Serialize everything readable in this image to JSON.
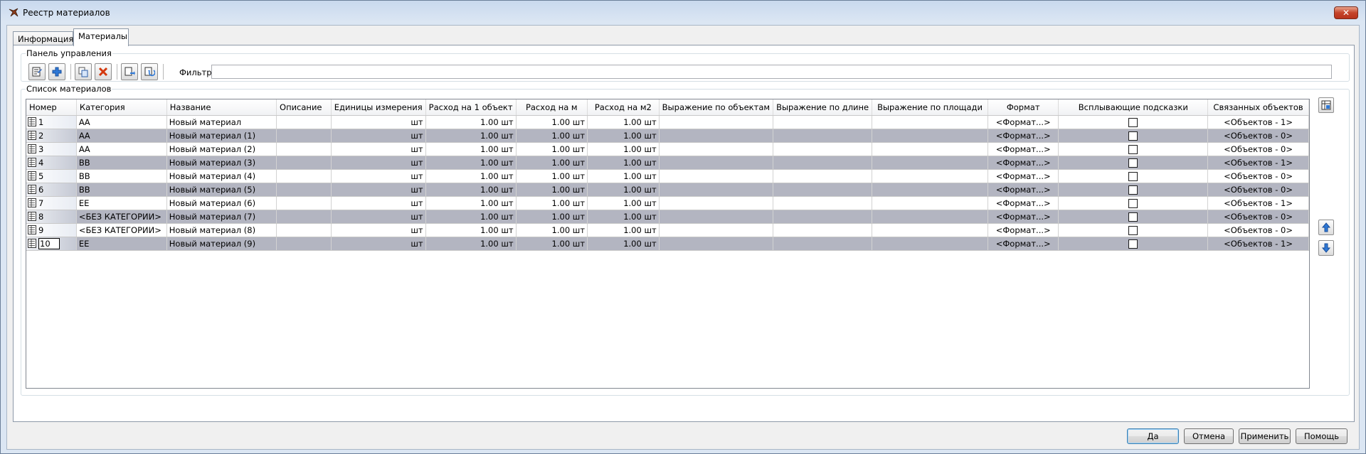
{
  "window": {
    "title": "Реестр материалов"
  },
  "tabs": [
    {
      "label": "Информация",
      "active": false
    },
    {
      "label": "Материалы",
      "active": true
    }
  ],
  "control_panel": {
    "title": "Панель управления",
    "buttons": [
      {
        "icon": "properties-icon"
      },
      {
        "icon": "add-icon"
      },
      {
        "icon": "copy-icon"
      },
      {
        "icon": "delete-icon"
      },
      {
        "icon": "export-icon"
      },
      {
        "icon": "import-icon"
      }
    ],
    "filter_label": "Фильтр:",
    "filter_value": ""
  },
  "materials": {
    "title": "Список материалов",
    "columns": [
      "Номер",
      "Категория",
      "Название",
      "Описание",
      "Единицы измерения",
      "Расход на 1 объект",
      "Расход на м",
      "Расход на м2",
      "Выражение по объектам",
      "Выражение по длине",
      "Выражение по площади",
      "Формат",
      "Всплывающие подсказки",
      "Связанных объектов"
    ],
    "rows": [
      {
        "num": "1",
        "category": "АА",
        "name": "Новый материал",
        "desc": "",
        "unit": "шт",
        "per_object": "1.00 шт",
        "per_m": "1.00 шт",
        "per_m2": "1.00 шт",
        "expr_obj": "",
        "expr_len": "",
        "expr_area": "",
        "format": "<Формат...>",
        "tooltip": false,
        "linked": "<Объектов - 1>"
      },
      {
        "num": "2",
        "category": "АА",
        "name": "Новый материал (1)",
        "desc": "",
        "unit": "шт",
        "per_object": "1.00 шт",
        "per_m": "1.00 шт",
        "per_m2": "1.00 шт",
        "expr_obj": "",
        "expr_len": "",
        "expr_area": "",
        "format": "<Формат...>",
        "tooltip": false,
        "linked": "<Объектов - 0>"
      },
      {
        "num": "3",
        "category": "АА",
        "name": "Новый материал (2)",
        "desc": "",
        "unit": "шт",
        "per_object": "1.00 шт",
        "per_m": "1.00 шт",
        "per_m2": "1.00 шт",
        "expr_obj": "",
        "expr_len": "",
        "expr_area": "",
        "format": "<Формат...>",
        "tooltip": false,
        "linked": "<Объектов - 0>"
      },
      {
        "num": "4",
        "category": "ВВ",
        "name": "Новый материал (3)",
        "desc": "",
        "unit": "шт",
        "per_object": "1.00 шт",
        "per_m": "1.00 шт",
        "per_m2": "1.00 шт",
        "expr_obj": "",
        "expr_len": "",
        "expr_area": "",
        "format": "<Формат...>",
        "tooltip": false,
        "linked": "<Объектов - 1>"
      },
      {
        "num": "5",
        "category": "ВВ",
        "name": "Новый материал (4)",
        "desc": "",
        "unit": "шт",
        "per_object": "1.00 шт",
        "per_m": "1.00 шт",
        "per_m2": "1.00 шт",
        "expr_obj": "",
        "expr_len": "",
        "expr_area": "",
        "format": "<Формат...>",
        "tooltip": false,
        "linked": "<Объектов - 0>"
      },
      {
        "num": "6",
        "category": "ВВ",
        "name": "Новый материал (5)",
        "desc": "",
        "unit": "шт",
        "per_object": "1.00 шт",
        "per_m": "1.00 шт",
        "per_m2": "1.00 шт",
        "expr_obj": "",
        "expr_len": "",
        "expr_area": "",
        "format": "<Формат...>",
        "tooltip": false,
        "linked": "<Объектов - 0>"
      },
      {
        "num": "7",
        "category": "ЕЕ",
        "name": "Новый материал (6)",
        "desc": "",
        "unit": "шт",
        "per_object": "1.00 шт",
        "per_m": "1.00 шт",
        "per_m2": "1.00 шт",
        "expr_obj": "",
        "expr_len": "",
        "expr_area": "",
        "format": "<Формат...>",
        "tooltip": false,
        "linked": "<Объектов - 1>"
      },
      {
        "num": "8",
        "category": "<БЕЗ КАТЕГОРИИ>",
        "name": "Новый материал (7)",
        "desc": "",
        "unit": "шт",
        "per_object": "1.00 шт",
        "per_m": "1.00 шт",
        "per_m2": "1.00 шт",
        "expr_obj": "",
        "expr_len": "",
        "expr_area": "",
        "format": "<Формат...>",
        "tooltip": false,
        "linked": "<Объектов - 0>"
      },
      {
        "num": "9",
        "category": "<БЕЗ КАТЕГОРИИ>",
        "name": "Новый материал (8)",
        "desc": "",
        "unit": "шт",
        "per_object": "1.00 шт",
        "per_m": "1.00 шт",
        "per_m2": "1.00 шт",
        "expr_obj": "",
        "expr_len": "",
        "expr_area": "",
        "format": "<Формат...>",
        "tooltip": false,
        "linked": "<Объектов - 0>"
      },
      {
        "num": "10",
        "category": "ЕЕ",
        "name": "Новый материал (9)",
        "desc": "",
        "unit": "шт",
        "per_object": "1.00 шт",
        "per_m": "1.00 шт",
        "per_m2": "1.00 шт",
        "expr_obj": "",
        "expr_len": "",
        "expr_area": "",
        "format": "<Формат...>",
        "tooltip": false,
        "linked": "<Объектов - 1>"
      }
    ],
    "side_buttons": [
      {
        "icon": "column-settings-icon"
      },
      {
        "icon": "move-up-icon"
      },
      {
        "icon": "move-down-icon"
      }
    ]
  },
  "dialog_buttons": {
    "ok": "Да",
    "cancel": "Отмена",
    "apply": "Применить",
    "help": "Помощь"
  },
  "colors": {
    "row_alt": "#b3b5c1",
    "titlebar": "#c9d9ee",
    "close": "#c5442a"
  }
}
